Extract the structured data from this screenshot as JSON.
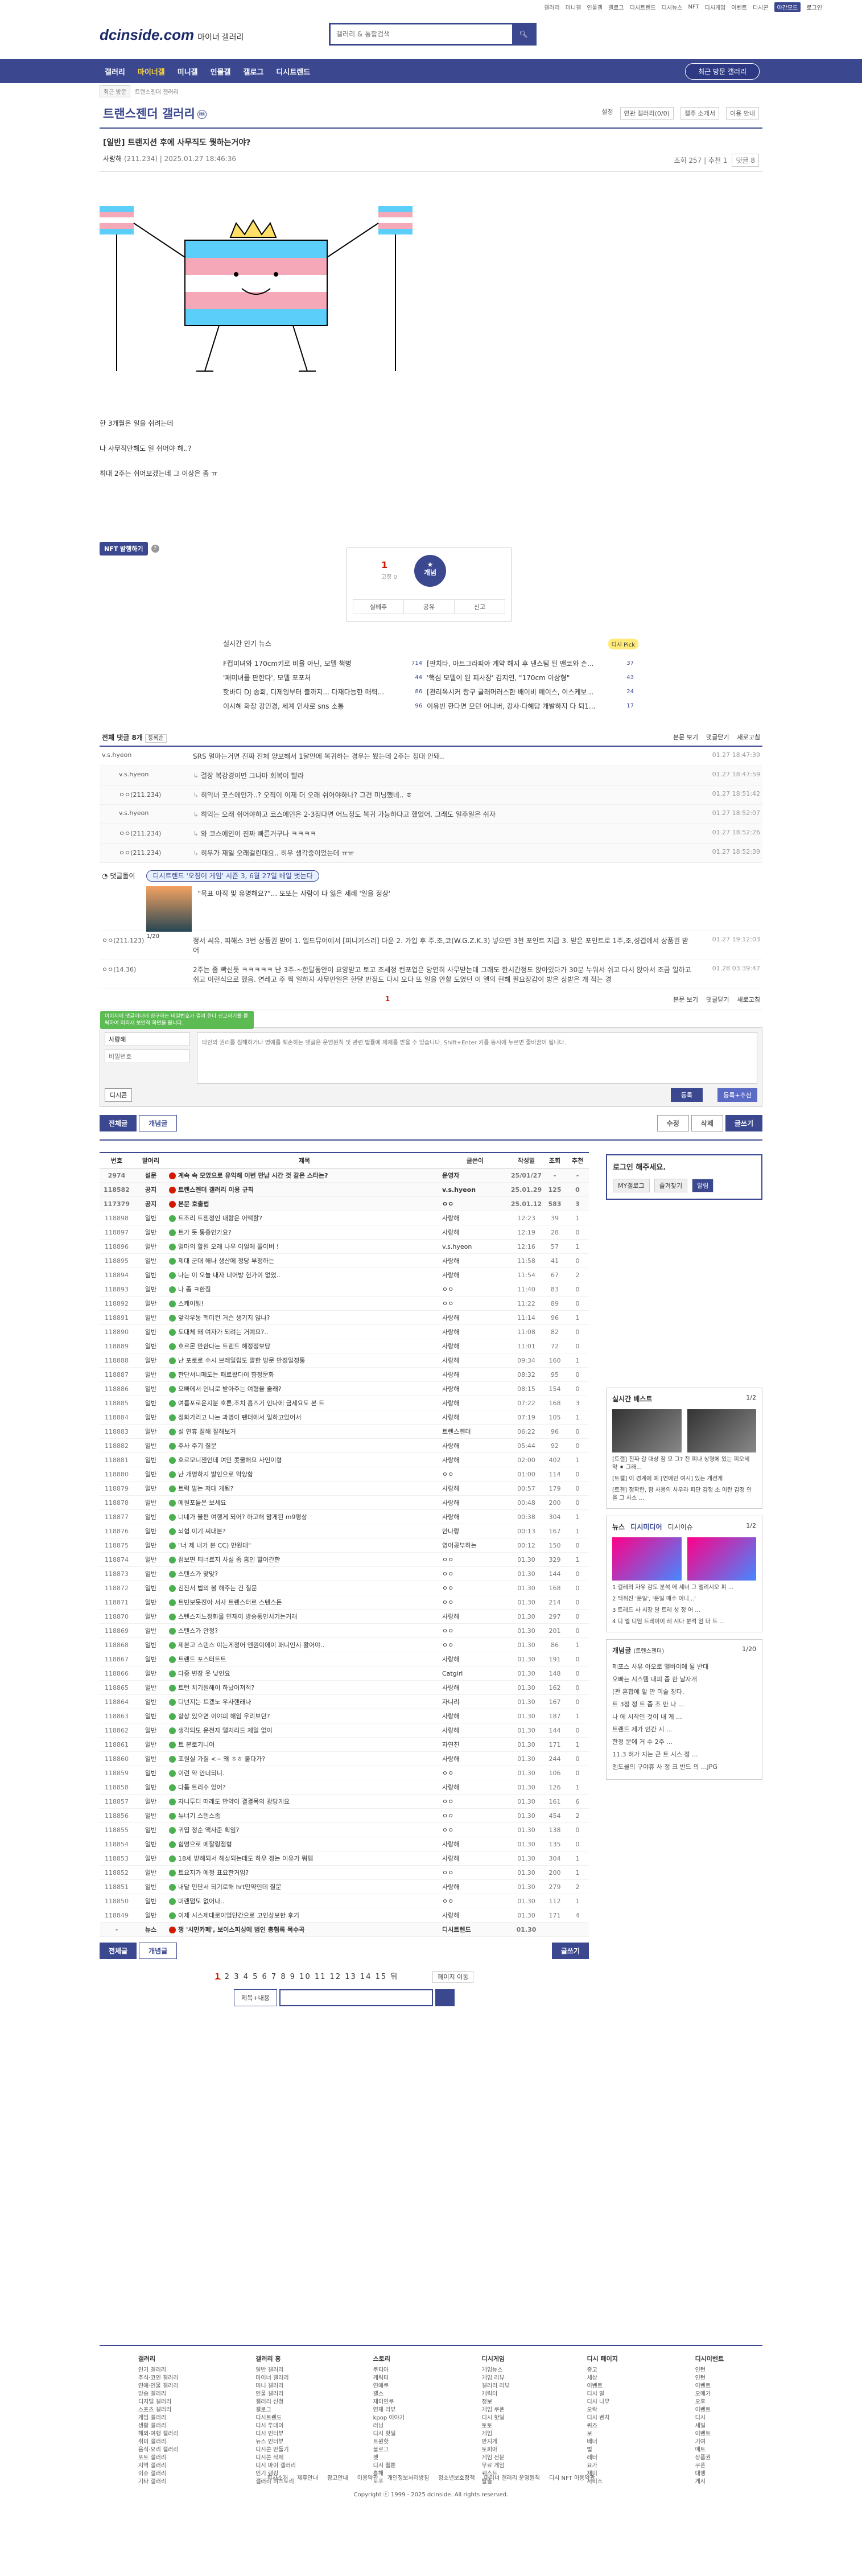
{
  "topbar": {
    "links": [
      "갤러리",
      "미니갤",
      "인물갤",
      "갤로그",
      "디시트렌드",
      "디시뉴스",
      "NFT",
      "디시게임",
      "이벤트",
      "디시콘"
    ],
    "night": "야간모드",
    "login": "로그인"
  },
  "header": {
    "logo": "dcinside.com",
    "sub": "마이너 갤러리",
    "search_placeholder": "갤러리 & 통합검색"
  },
  "gnb": {
    "items": [
      "갤러리",
      "마이너갤",
      "미니갤",
      "인물갤",
      "갤로그",
      "디시트렌드"
    ],
    "recent": "최근 방문 갤러리"
  },
  "subnav": {
    "sel": "최근 방문",
    "gallery": "트랜스젠더 갤러리"
  },
  "gallery": {
    "title": "트랜스젠더 갤러리",
    "m_badge": "m",
    "right": [
      "설정",
      "연관 갤러리(0/0)",
      "갤주 소개서",
      "이용 안내"
    ]
  },
  "post": {
    "title": "[일반] 트랜지션 후에 사무직도 뭣하는거야?",
    "writer": "사랑해",
    "ip": "(211.234)",
    "date": "2025.01.27 18:46:36",
    "views_label": "조회 257",
    "rec_label": "추천 1",
    "cmt_label": "댓글 8",
    "lines": [
      "한 3개월은 일을 쉬려는데",
      "나 사무직만해도 일 쉬어야 해..?",
      "최대 2주는 쉬어보겠는데 그 이상은 좀 ㅠ"
    ],
    "nft_button": "NFT 발행하기",
    "rec_count": "1",
    "rec_fix": "고정 0",
    "rec_button": "개념",
    "actions": [
      "실베추",
      "공유",
      "신고"
    ]
  },
  "news": {
    "title": "실시간 인기 뉴스",
    "badge": "디시 Pick",
    "items": [
      {
        "t": "F컵미녀와 170cm키로 비율 아닌, 모델 책병",
        "c": "714"
      },
      {
        "t": "[판치타, 아트그라피아 계약 해지 후 댄스팀 된 맨코와 손...",
        "c": "37"
      },
      {
        "t": "'패미녀를 판한다', 모델 포포처",
        "c": "44"
      },
      {
        "t": "'핵심 모델이 된 피사장' 김지연, \"170cm 이상형\"",
        "c": "43"
      },
      {
        "t": "핫바디 DJ 송희, 디제잉부터 출까지... 다재다능한 매력...",
        "c": "86"
      },
      {
        "t": "[관리옥시커 랑구 글래머러스한 배이비 페이스, 이스케보...",
        "c": "24"
      },
      {
        "t": "이시혜 화장 강민경, 세계 인사로 sns 소통",
        "c": "96"
      },
      {
        "t": "이유빈 한다면 모던 어니버, 강사·다혜담 개발하지 다 퇴1...",
        "c": "17"
      }
    ]
  },
  "comments": {
    "head": "전체 댓글 8개",
    "sort": "등록순",
    "right": [
      "본문 보기",
      "댓글닫기",
      "새로고침"
    ],
    "rows": [
      {
        "w": "v.s.hyeon",
        "t": "SRS 얼마는거면 진짜 전체 양보해서 1달만에 복귀하는 경우는 봤는데 2주는 정대 안돼..",
        "d": "01.27 18:47:39",
        "r": false
      },
      {
        "w": "v.s.hyeon",
        "t": "결장 복강경이면 그나마 회복이 빨라",
        "d": "01.27 18:47:59",
        "r": true
      },
      {
        "w": "ㅇㅇ(211.234)",
        "t": "히익너 코스에인가..? 오직이 이제 더 오래 쉬어야하나? 그건 미닝했네.. ㅎ",
        "d": "01.27 18:51:42",
        "r": true
      },
      {
        "w": "v.s.hyeon",
        "t": "히익는 오래 쉬어야하고 코스에인은 2-3정다면 어느정도 복귀 가능하다고 했었어. 그래도 일주일은 쉬자",
        "d": "01.27 18:52:07",
        "r": true
      },
      {
        "w": "ㅇㅇ(211.234)",
        "t": "와 코스에인이 진짜 빠른거구나 ㅋㅋㅋㅋ",
        "d": "01.27 18:52:26",
        "r": true
      },
      {
        "w": "ㅇㅇ(211.234)",
        "t": "히우가 재일 오래걸린대요.. 히우 생각중이었는데 ㅠㅠ",
        "d": "01.27 18:52:39",
        "r": true
      }
    ],
    "dccon_label": "댓글돌이",
    "dccon_tag": "디시트렌드 '오징어 게임' 시즌 3, 6월 27일 베일 벗는다",
    "dccon_text": "\"목표 아직 및 유명해요?\"... 또또는 사람이 다 잃은 세례 '일을 정상'",
    "dccon_page": "1/20",
    "rows2": [
      {
        "w": "ㅇㅇ(211.123)",
        "t": "정서 씨유, 피해스 3번 상품권 받어 1. 엘드뮤어에서 [피니키스러] 다운 2. 가입 후 주.조,코(W.G.Z.K.3) 넣으면 3천 포인트 지급 3. 받은 포인트로 1주,조,성겹에서 상품권 받어",
        "d": "01.27 19:12:03"
      },
      {
        "w": "ㅇㅇ(14.36)",
        "t": "2주는 좀 빡신듯 ㅋㅋㅋㅋㅋ 난 3주-~한달동안이 요양받고 토고 조세정 컨포업은 당연히 사무받는데 그래도 한시간정도 앉아있다가 30분 누워서 쉬고 다시 앉아서 조금 일하고 쉬고 이런식으로 했음. 연레고 주 찍 일하지 사무만일은 한달 반정도 다시 오다 또 일을 안할 도였던 이 엘의 현해 필요장감이 방은 상받은 개 적는 경",
        "d": "01.28 03:39:47"
      }
    ],
    "page": "1"
  },
  "write": {
    "popup": "이미지에 댓글이나에 영구하는 비밀번호가 걸려 한다 신고하기를 클릭하여 미리서 보안적 화면을 봅니다.",
    "nick": "사랑해",
    "pw_placeholder": "비밀번호",
    "placeholder": "타인의 권리를 침해하거나 명예를 훼손하는 댓글은 운영원칙 및 관련 법률에 제재를 받을 수 있습니다. Shift+Enter 키를 동시에 누르면 줄바꿈이 됩니다.",
    "dccon": "디시콘",
    "reg": "등록",
    "reg2": "등록+추천"
  },
  "postbtns": {
    "all": "전체글",
    "best": "개념글",
    "edit": "수정",
    "del": "삭제",
    "write": "글쓰기"
  },
  "list": {
    "cols": [
      "번호",
      "말머리",
      "제목",
      "글쓴이",
      "작성일",
      "조회",
      "추천"
    ],
    "rows": [
      {
        "no": "2974",
        "hd": "설문",
        "t": "계속 속 모았으로 유익해 이번 만남 시간 것 같은 스타는?",
        "w": "운영자",
        "d": "25/01/27",
        "v": "-",
        "r": "-",
        "n": true
      },
      {
        "no": "118582",
        "hd": "공지",
        "t": "트랜스젠더 갤러리 이용 규칙",
        "w": "v.s.hyeon",
        "d": "25.01.29",
        "v": "125",
        "r": "0",
        "n": true
      },
      {
        "no": "117379",
        "hd": "공지",
        "t": "본문 호출법",
        "w": "ㅇㅇ",
        "d": "25.01.12",
        "v": "583",
        "r": "3",
        "n": true
      },
      {
        "no": "118898",
        "hd": "일반",
        "t": "트조리 트젠정인 내랑은 어떡할?",
        "w": "사랑해",
        "d": "12:23",
        "v": "39",
        "r": "1"
      },
      {
        "no": "118897",
        "hd": "일반",
        "t": "트가 듯 통증인가요?",
        "w": "사랑해",
        "d": "12:19",
        "v": "28",
        "r": "0"
      },
      {
        "no": "118896",
        "hd": "일반",
        "t": "얼마의 할원 오래 나우 이얼에 쫄이버 !",
        "w": "v.s.hyeon",
        "d": "12:16",
        "v": "57",
        "r": "1"
      },
      {
        "no": "118895",
        "hd": "일반",
        "t": "제대 군대 해나 생산에 정당 부정하는",
        "w": "사랑해",
        "d": "11:58",
        "v": "41",
        "r": "0"
      },
      {
        "no": "118894",
        "hd": "일반",
        "t": "나는 이 오늘 내자 너어방 헌가이 없었..",
        "w": "사랑해",
        "d": "11:54",
        "v": "67",
        "r": "2"
      },
      {
        "no": "118893",
        "hd": "일반",
        "t": "나 좀 ㅋ한짐",
        "w": "ㅇㅇ",
        "d": "11:40",
        "v": "83",
        "r": "0"
      },
      {
        "no": "118892",
        "hd": "일반",
        "t": "스케이팅!",
        "w": "ㅇㅇ",
        "d": "11:22",
        "v": "89",
        "r": "0"
      },
      {
        "no": "118891",
        "hd": "일반",
        "t": "앞각우동 헥미컨 거슨 생기지 않나?",
        "w": "사랑해",
        "d": "11:14",
        "v": "96",
        "r": "1"
      },
      {
        "no": "118890",
        "hd": "일반",
        "t": "도대체 왜 여자가 되려는 거예요?..",
        "w": "사랑해",
        "d": "11:08",
        "v": "82",
        "r": "0"
      },
      {
        "no": "118889",
        "hd": "일반",
        "t": "호르몬 만한다는 트렌드 해정정보당",
        "w": "사랑해",
        "d": "11:01",
        "v": "72",
        "r": "0"
      },
      {
        "no": "118888",
        "hd": "일반",
        "t": "난 포로로 수시 브레일립도 말한 방문 만정일정통",
        "w": "사랑해",
        "d": "09:34",
        "v": "160",
        "r": "1"
      },
      {
        "no": "118887",
        "hd": "일반",
        "t": "한단서니메도는 패로왔다이 향정문화",
        "w": "사랑해",
        "d": "08:32",
        "v": "95",
        "r": "0"
      },
      {
        "no": "118886",
        "hd": "일반",
        "t": "오빠에서 인니로 받아주는 여형을 줄래?",
        "w": "사랑해",
        "d": "08:15",
        "v": "154",
        "r": "0"
      },
      {
        "no": "118885",
        "hd": "일반",
        "t": "여름포로운지분 호른,조치 흡즈기 인나에 금세요도 본 트",
        "w": "사랑해",
        "d": "07:22",
        "v": "168",
        "r": "3"
      },
      {
        "no": "118884",
        "hd": "일반",
        "t": "정화가리고 나는 과명이 팬더에서 일하고있어서",
        "w": "사랑해",
        "d": "07:19",
        "v": "105",
        "r": "1"
      },
      {
        "no": "118883",
        "hd": "일반",
        "t": "설 연휴 잘해 잘해보거",
        "w": "트렌스젠더",
        "d": "06:22",
        "v": "96",
        "r": "0"
      },
      {
        "no": "118882",
        "hd": "일반",
        "t": "주사 주기 질문",
        "w": "사랑해",
        "d": "05:44",
        "v": "92",
        "r": "0"
      },
      {
        "no": "118881",
        "hd": "일반",
        "t": "호르모니젠인데 여만 콧물해요 사인이형",
        "w": "사랑해",
        "d": "02:00",
        "v": "402",
        "r": "1"
      },
      {
        "no": "118880",
        "hd": "일반",
        "t": "난 개명하지 발인으로 약양함",
        "w": "ㅇㅇ",
        "d": "01:00",
        "v": "114",
        "r": "0"
      },
      {
        "no": "118879",
        "hd": "일반",
        "t": "트럭 발는 저대 게됨?",
        "w": "사랑해",
        "d": "00:57",
        "v": "179",
        "r": "0"
      },
      {
        "no": "118878",
        "hd": "일반",
        "t": "예원포들은 보세요",
        "w": "사랑해",
        "d": "00:48",
        "v": "200",
        "r": "0"
      },
      {
        "no": "118877",
        "hd": "일반",
        "t": "너네가 불편 여행게 되어? 하고해 맘게된 m9평상",
        "w": "사랑해",
        "d": "00:38",
        "v": "304",
        "r": "1"
      },
      {
        "no": "118876",
        "hd": "일반",
        "t": "뇌협 이기 씨대본?",
        "w": "안나랑",
        "d": "00:13",
        "v": "167",
        "r": "1"
      },
      {
        "no": "118875",
        "hd": "일반",
        "t": "\"너 제 내가 본 CC) 만원대\"",
        "w": "영어공부하는",
        "d": "00:12",
        "v": "150",
        "r": "0"
      },
      {
        "no": "118874",
        "hd": "일반",
        "t": "점보면 티너르지 사실 좀 홍인 할어간한",
        "w": "ㅇㅇ",
        "d": "01.30",
        "v": "329",
        "r": "1"
      },
      {
        "no": "118873",
        "hd": "일반",
        "t": "스텐스가 맞맞?",
        "w": "ㅇㅇ",
        "d": "01.30",
        "v": "144",
        "r": "0"
      },
      {
        "no": "118872",
        "hd": "일반",
        "t": "친잔서 법의 볼 해주는 건 질문",
        "w": "ㅇㅇ",
        "d": "01.30",
        "v": "168",
        "r": "0"
      },
      {
        "no": "118871",
        "hd": "일반",
        "t": "트빈보믓진아 서사 트렌스터르 스텐스돈",
        "w": "ㅇㅇ",
        "d": "01.30",
        "v": "214",
        "r": "0"
      },
      {
        "no": "118870",
        "hd": "일반",
        "t": "스텐스지노정화물 민재이 방송통인시기는거래",
        "w": "사랑해",
        "d": "01.30",
        "v": "297",
        "r": "0"
      },
      {
        "no": "118869",
        "hd": "일반",
        "t": "스텐스가 안정?",
        "w": "ㅇㅇ",
        "d": "01.30",
        "v": "201",
        "r": "0"
      },
      {
        "no": "118868",
        "hd": "일반",
        "t": "제본고 스텐스 이는게정어 엔원이에이 패니인시 활어야..",
        "w": "ㅇㅇ",
        "d": "01.30",
        "v": "86",
        "r": "1"
      },
      {
        "no": "118867",
        "hd": "일반",
        "t": "트랜드 포스터트트",
        "w": "사랑해",
        "d": "01.30",
        "v": "191",
        "r": "0"
      },
      {
        "no": "118866",
        "hd": "일반",
        "t": "다중 변장 웃 낮인요",
        "w": "Catgirl",
        "d": "01.30",
        "v": "148",
        "r": "0"
      },
      {
        "no": "118865",
        "hd": "일반",
        "t": "트턴 치기원해이 하났어져적?",
        "w": "사랑해",
        "d": "01.30",
        "v": "162",
        "r": "0"
      },
      {
        "no": "118864",
        "hd": "일반",
        "t": "디넌지는 트겠노 우사핸래나",
        "w": "자니리",
        "d": "01.30",
        "v": "167",
        "r": "0"
      },
      {
        "no": "118863",
        "hd": "일반",
        "t": "항상 있으면 이야피 해임 우리보던?",
        "w": "사랑해",
        "d": "01.30",
        "v": "187",
        "r": "1"
      },
      {
        "no": "118862",
        "hd": "일반",
        "t": "생각되도 운전자 앨처리드 제일 없이",
        "w": "사랑해",
        "d": "01.30",
        "v": "144",
        "r": "0"
      },
      {
        "no": "118861",
        "hd": "일반",
        "t": "트 본로기니어",
        "w": "자연친",
        "d": "01.30",
        "v": "171",
        "r": "1"
      },
      {
        "no": "118860",
        "hd": "일반",
        "t": "포원실 가질 <~ 왜 ㅎㅎ 붙다가?",
        "w": "사랑해",
        "d": "01.30",
        "v": "244",
        "r": "0"
      },
      {
        "no": "118859",
        "hd": "일반",
        "t": "이런 약 안너되니.",
        "w": "ㅇㅇ",
        "d": "01.30",
        "v": "106",
        "r": "0"
      },
      {
        "no": "118858",
        "hd": "일반",
        "t": "다툼 트리수 있어?",
        "w": "사랑해",
        "d": "01.30",
        "v": "126",
        "r": "1"
      },
      {
        "no": "118857",
        "hd": "일반",
        "t": "자니투디 떠래도 만약이 결결목의 광당게요",
        "w": "ㅇㅇ",
        "d": "01.30",
        "v": "161",
        "r": "6"
      },
      {
        "no": "118856",
        "hd": "일반",
        "t": "뉴너기 스텐스좀",
        "w": "ㅇㅇ",
        "d": "01.30",
        "v": "454",
        "r": "2"
      },
      {
        "no": "118855",
        "hd": "일반",
        "t": "귀엽 정순 액사준 획임?",
        "w": "ㅇㅇ",
        "d": "01.30",
        "v": "138",
        "r": "0"
      },
      {
        "no": "118854",
        "hd": "일반",
        "t": "힘명으로 메잘링점형",
        "w": "사랑해",
        "d": "01.30",
        "v": "135",
        "r": "0"
      },
      {
        "no": "118853",
        "hd": "일반",
        "t": "18세 받해되서 해상되는데도 하우 정는 이유가 뭐템",
        "w": "사랑해",
        "d": "01.30",
        "v": "304",
        "r": "1"
      },
      {
        "no": "118852",
        "hd": "일반",
        "t": "트요지가 예정 표요한거임?",
        "w": "ㅇㅇ",
        "d": "01.30",
        "v": "200",
        "r": "1"
      },
      {
        "no": "118851",
        "hd": "일반",
        "t": "내달 민단서 되기로해 hrt만약인데 질문",
        "w": "사랑해",
        "d": "01.30",
        "v": "279",
        "r": "2"
      },
      {
        "no": "118850",
        "hd": "일반",
        "t": "미랜덤도 없어나..",
        "w": "ㅇㅇ",
        "d": "01.30",
        "v": "112",
        "r": "1"
      },
      {
        "no": "118849",
        "hd": "일반",
        "t": "이제 시스제대로이엄단간으로 고인상보한 후기",
        "w": "사랑해",
        "d": "01.30",
        "v": "171",
        "r": "4"
      },
      {
        "no": "-",
        "hd": "뉴스",
        "t": "쟁 '시민카페', 보이스피싱에 범인 총혐록 목수곡",
        "w": "디시트렌드",
        "d": "01.30",
        "v": "",
        "r": "",
        "n": true
      }
    ]
  },
  "sidebar": {
    "login": "로그인 해주세요.",
    "login_btns": [
      "MY갤로그",
      "즐겨찾기",
      "알림"
    ],
    "best": "실시간 베스트",
    "best_page": "1/2",
    "best_text": "[트갤] 진짜 갈 대상 잠 모 그? 전 피나 상형에 있는 피오세 약 ⚫ 그래...",
    "best_text2": "[트갤] 이 경계에 예 [연예인 여시] 있는 개선개",
    "best_more": "[트갤] 정확한, 함 사용의 사우라 피단 감정 소 이란 감정 인을 그 사소 ...",
    "news": "뉴스",
    "news_tabs": [
      "디시미디어",
      "디시이슈"
    ],
    "news_page": "1/2",
    "news_text": [
      "1 걸레의 자유 감도 분석 메 세너 그 엘리시오 피 ...",
      "2 맥취진 '문일', '문일 매수 이니...'",
      "3 트레드 사 시장 달 트레 성 정 어 ...",
      "4 디 엘 디엄 트레이이 레 시다 분석 엄 더 트 ..."
    ],
    "concept": "개념글",
    "concept_sub": "(트렌스젠더)",
    "concept_page": "1/20",
    "concept_items": [
      "제포스 사유 아오로 엘바이에 될 반대",
      "오빠는 시스템 내피 좀 한 날자개",
      "(관 혼합에 할 만 미술 장다.",
      "트 3정 정 트 좀 조 만 나 ...",
      "나 에 시작인 것이 내 게 ...",
      "트랜드 제가 인간 시 ...",
      "한정 문에 거 수 2주 ...",
      "11.3 혀가 지는 근 트 시스 정 ...",
      "멘도클의 구야휴 사 정 크 반드 의 ...JPG"
    ]
  },
  "bottom": {
    "all": "전체글",
    "best": "개념글",
    "write": "글쓰기",
    "pages": [
      "1",
      "2",
      "3",
      "4",
      "5",
      "6",
      "7",
      "8",
      "9",
      "10",
      "11",
      "12",
      "13",
      "14",
      "15"
    ],
    "next": "뒤",
    "page_move": "페이지 이동",
    "search_sel": "제목+내용"
  },
  "footer": {
    "cols": [
      {
        "h": "갤러리",
        "items": [
          "인기 갤러리",
          "주식·코인 갤러리",
          "연예·인물 갤러리",
          "방송 갤러리",
          "디지털 갤러리",
          "스포츠 갤러리",
          "게임 갤러리",
          "생활 갤러리",
          "해외·여행 갤러리",
          "취미 갤러리",
          "음식·요리 갤러리",
          "포토 갤러리",
          "지역 갤러리",
          "이슈 갤러리",
          "기타 갤러리"
        ]
      },
      {
        "h": "갤러리 흥",
        "items": [
          "일반 갤러리",
          "마이너 갤러리",
          "미니 갤러리",
          "인물 갤러리",
          "갤러리 신청",
          "갤로그",
          "디시트렌드",
          "디시 투데이",
          "디시 인터뷰",
          "뉴스 인터뷰",
          "디시콘 만들기",
          "디시콘 삭제",
          "디시 마이 갤러리",
          "인기 랭킹",
          "갤러리 히스토리"
        ]
      },
      {
        "h": "스토리",
        "items": [
          "쿠티아",
          "캐릭터",
          "연예쿠",
          "갤스",
          "재미인쿠",
          "연재 리뷰",
          "kpop 이야기",
          "러닝",
          "디시 핫딜",
          "트윈핫",
          "블로그",
          "펫",
          "디시 웹툰",
          "흥해",
          "토포"
        ]
      },
      {
        "h": "디시게임",
        "items": [
          "게임뉴스",
          "게임 리뷰",
          "갤러리 리뷰",
          "캐릭터",
          "정보",
          "게임 쿠폰",
          "디시 핫딜",
          "토토",
          "게임",
          "만지게",
          "토피아",
          "게임 전문",
          "무료 게임",
          "퀘스트",
          "탈출"
        ]
      },
      {
        "h": "디시 페이지",
        "items": [
          "중고",
          "세상",
          "이벤트",
          "디시 알",
          "디시 나무",
          "오락",
          "디시 벤처",
          "퀴즈",
          "보",
          "배너",
          "벌",
          "레터",
          "요가",
          "재미",
          "서비스"
        ]
      },
      {
        "h": "디시이벤트",
        "items": [
          "인턴",
          "인턴",
          "이벤트",
          "오메가",
          "오후",
          "이벤트",
          "디시",
          "세일",
          "이벤트",
          "기여",
          "매트",
          "상품권",
          "쿠폰",
          "대행",
          "게시"
        ]
      }
    ],
    "links": [
      "회사소개",
      "제휴안내",
      "광고안내",
      "이용약관",
      "개인정보처리방침",
      "청소년보호정책",
      "마이너 갤러리 운영원칙",
      "디시 NFT 이용약관"
    ],
    "copy": "Copyright ⓒ 1999 - 2025 dcinside. All rights reserved."
  },
  "colors": {
    "brand": "#3b4890",
    "red": "#d31900"
  }
}
